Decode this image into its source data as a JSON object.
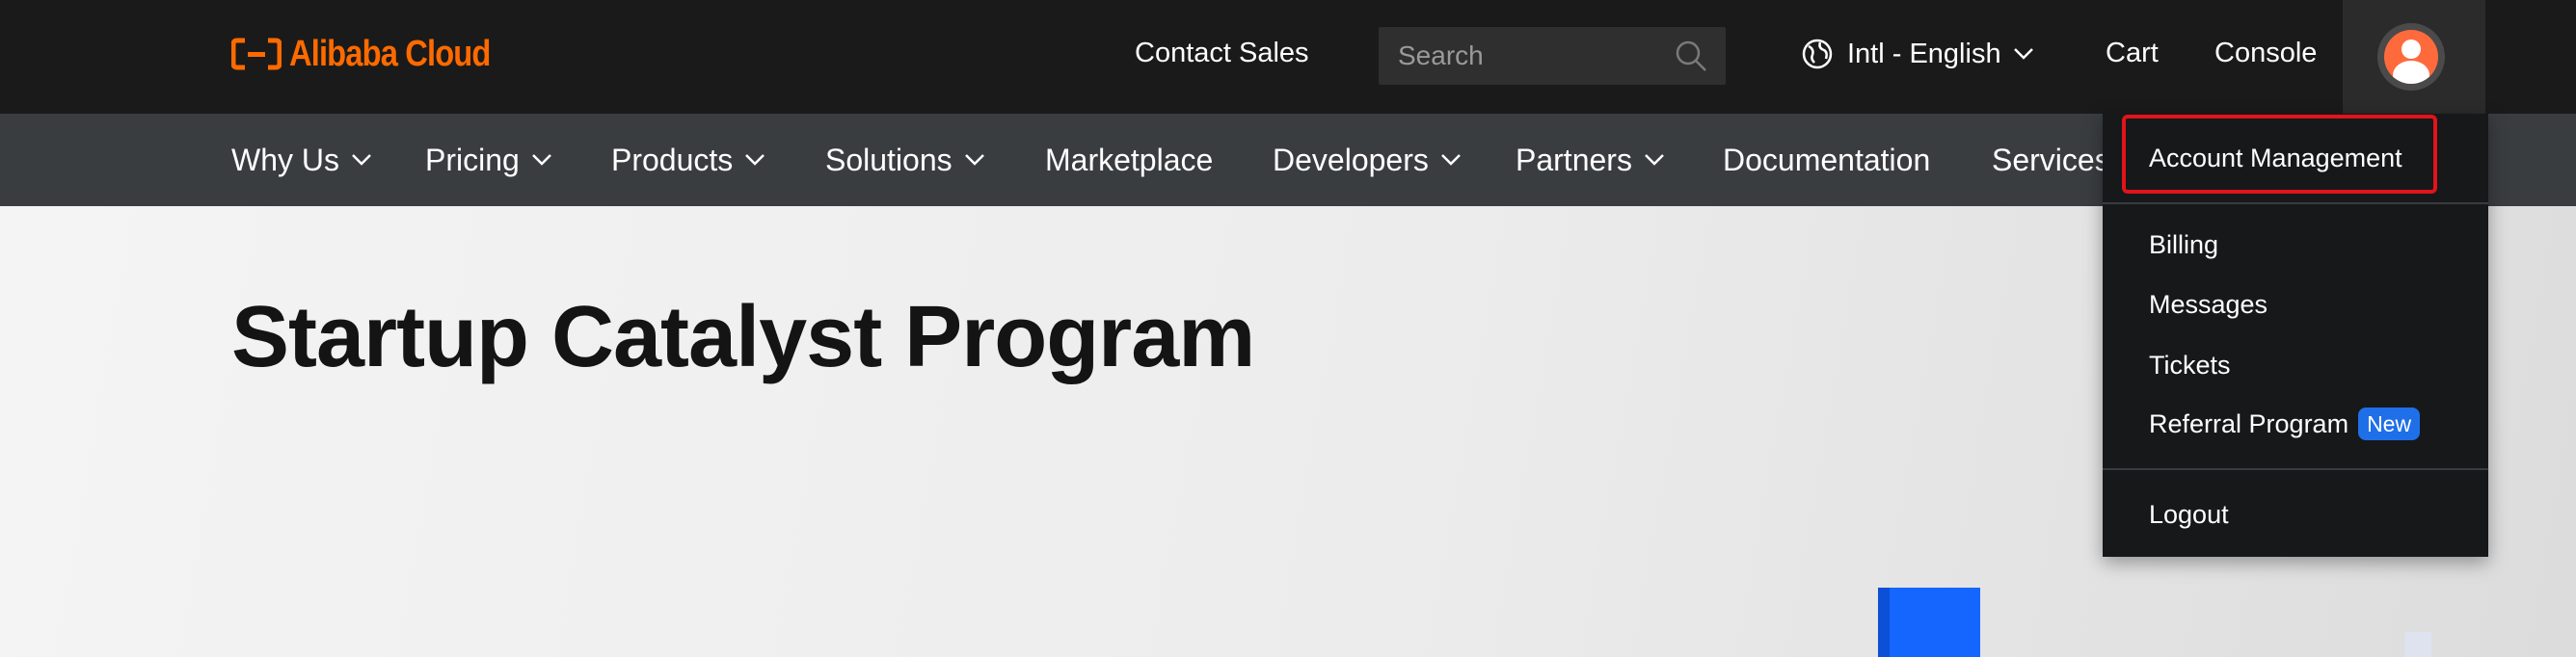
{
  "header": {
    "logo_text": "Alibaba Cloud",
    "contact_sales": "Contact Sales",
    "search_placeholder": "Search",
    "language": "Intl - English",
    "cart": "Cart",
    "console": "Console"
  },
  "nav": {
    "items": [
      {
        "label": "Why Us",
        "has_dropdown": true
      },
      {
        "label": "Pricing",
        "has_dropdown": true
      },
      {
        "label": "Products",
        "has_dropdown": true
      },
      {
        "label": "Solutions",
        "has_dropdown": true
      },
      {
        "label": "Marketplace",
        "has_dropdown": false
      },
      {
        "label": "Developers",
        "has_dropdown": true
      },
      {
        "label": "Partners",
        "has_dropdown": true
      },
      {
        "label": "Documentation",
        "has_dropdown": false
      },
      {
        "label": "Services",
        "has_dropdown": false
      }
    ]
  },
  "hero": {
    "title": "Startup Catalyst Program"
  },
  "account_menu": {
    "items": [
      {
        "label": "Account Management"
      },
      {
        "label": "Billing"
      },
      {
        "label": "Messages"
      },
      {
        "label": "Tickets"
      },
      {
        "label": "Referral Program",
        "badge": "New"
      },
      {
        "label": "Logout"
      }
    ]
  },
  "colors": {
    "brand": "#ff6a00",
    "topbar_bg": "#1a1a1a",
    "navbar_bg": "#3a3d40",
    "badge_bg": "#1f6fe8",
    "highlight": "#e0141a",
    "hero_shape": "#1466ff"
  }
}
